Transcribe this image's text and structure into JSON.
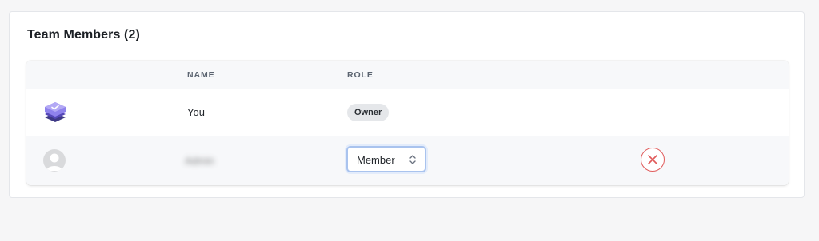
{
  "section": {
    "title": "Team Members (2)"
  },
  "table": {
    "columns": {
      "avatar": "",
      "name": "NAME",
      "role": "ROLE"
    },
    "rows": [
      {
        "avatar_icon": "app-logo-icon",
        "name": "You",
        "role": "Owner",
        "role_editable": false
      },
      {
        "avatar_icon": "user-avatar-icon",
        "name": "Admin",
        "name_obscured": true,
        "role": "Member",
        "role_editable": true,
        "remove_icon": "close-icon"
      }
    ]
  },
  "colors": {
    "accent_focus": "#a9c3ee",
    "danger": "#e05a5a",
    "badge_bg": "#e5e7ea",
    "app_logo": "#6b5fd6"
  }
}
